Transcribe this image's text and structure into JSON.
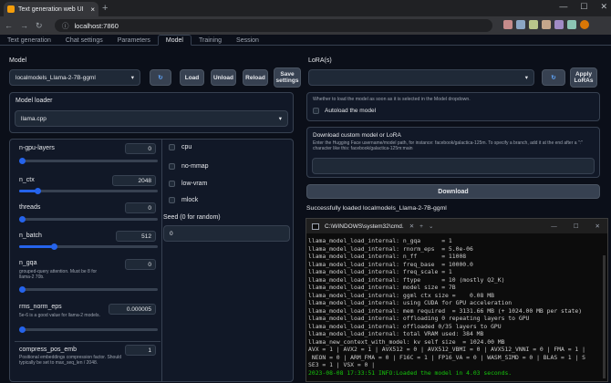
{
  "browser": {
    "tab_title": "Text generation web UI",
    "url": "localhost:7860",
    "new_tab_symbol": "+",
    "close_symbol": "×"
  },
  "app_tabs": [
    "Text generation",
    "Chat settings",
    "Parameters",
    "Model",
    "Training",
    "Session"
  ],
  "active_tab": "Model",
  "model": {
    "label": "Model",
    "selected": "localmodels_Llama-2-7B-ggml",
    "load": "Load",
    "unload": "Unload",
    "reload": "Reload",
    "save_settings": "Save settings"
  },
  "lora": {
    "label": "LoRA(s)",
    "apply": "Apply LoRAs"
  },
  "loader": {
    "label": "Model loader",
    "selected": "llama.cpp"
  },
  "params": {
    "n_gpu_layers": {
      "label": "n-gpu-layers",
      "value": "0",
      "fraction": 0.0
    },
    "n_ctx": {
      "label": "n_ctx",
      "value": "2048",
      "fraction": 0.13
    },
    "threads": {
      "label": "threads",
      "value": "0",
      "fraction": 0.0
    },
    "n_batch": {
      "label": "n_batch",
      "value": "512",
      "fraction": 0.25
    },
    "n_gqa": {
      "label": "n_gqa",
      "value": "0",
      "info": "grouped-query attention. Must be 8 for llama-2 70b.",
      "fraction": 0.0
    },
    "rms_norm_eps": {
      "label": "rms_norm_eps",
      "value": "0.000005",
      "info": "5e-6 is a good value for llama-2 models.",
      "fraction": 0.0
    },
    "compress_pos_emb": {
      "label": "compress_pos_emb",
      "value": "1",
      "info": "Positional embeddings compression factor. Should typically be set to max_seq_len / 2048."
    }
  },
  "checkboxes": [
    "cpu",
    "no-mmap",
    "low-vram",
    "mlock"
  ],
  "seed": {
    "label": "Seed (0 for random)",
    "value": "0"
  },
  "autoload": {
    "info": "Whether to load the model as soon as it is selected in the Model dropdown.",
    "label": "Autoload the model"
  },
  "download": {
    "title": "Download custom model or LoRA",
    "info": "Enter the Hugging Face username/model path, for instance: facebook/galactica-125m. To specify a branch, add it at the end after a \":\" character like this: facebook/galactica-125m:main",
    "button": "Download"
  },
  "status": "Successfully loaded localmodels_Llama-2-7B-ggml",
  "terminal": {
    "title": "C:\\WINDOWS\\system32\\cmd.",
    "lines": [
      "llama_model_load_internal: n_gqa      = 1",
      "llama_model_load_internal: rnorm_eps  = 5.0e-06",
      "llama_model_load_internal: n_ff       = 11008",
      "llama_model_load_internal: freq_base  = 10000.0",
      "llama_model_load_internal: freq_scale = 1",
      "llama_model_load_internal: ftype      = 10 (mostly Q2_K)",
      "llama_model_load_internal: model size = 7B",
      "llama_model_load_internal: ggml ctx size =    0.08 MB",
      "llama_model_load_internal: using CUDA for GPU acceleration",
      "llama_model_load_internal: mem required  = 3131.66 MB (+ 1024.00 MB per state)",
      "llama_model_load_internal: offloading 0 repeating layers to GPU",
      "llama_model_load_internal: offloaded 0/35 layers to GPU",
      "llama_model_load_internal: total VRAM used: 384 MB",
      "llama_new_context_with_model: kv self size  = 1024.00 MB",
      "AVX = 1 | AVX2 = 1 | AVX512 = 0 | AVX512_VBMI = 0 | AVX512_VNNI = 0 | FMA = 1 |",
      " NEON = 0 | ARM_FMA = 0 | F16C = 1 | FP16_VA = 0 | WASM_SIMD = 0 | BLAS = 1 | S",
      "SE3 = 1 | VSX = 0 |"
    ],
    "last_line": "2023-08-08 17:33:51 INFO:Loaded the model in 4.03 seconds.",
    "last_line_color": "#16c60c"
  },
  "colors": {
    "accent": "#2563eb",
    "bg": "#0b0f19"
  }
}
